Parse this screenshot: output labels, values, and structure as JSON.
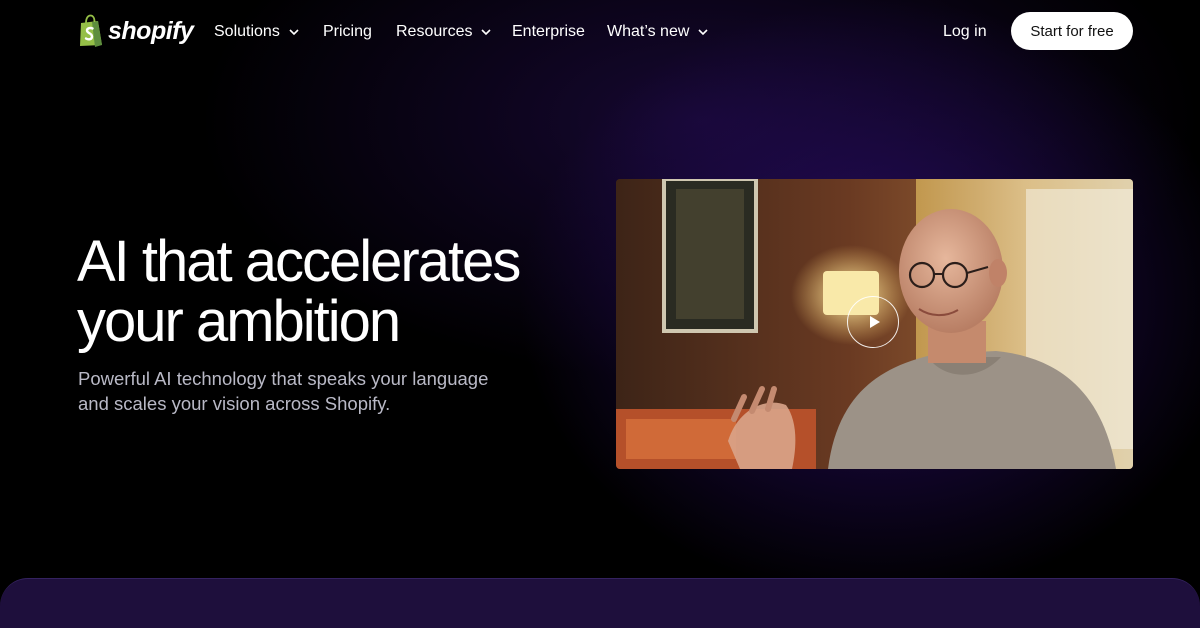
{
  "brand": {
    "name": "shopify",
    "logo_icon": "shopping-bag-icon",
    "logo_color": "#95bf47"
  },
  "nav": {
    "items": [
      {
        "label": "Solutions",
        "has_dropdown": true
      },
      {
        "label": "Pricing",
        "has_dropdown": false
      },
      {
        "label": "Resources",
        "has_dropdown": true
      },
      {
        "label": "Enterprise",
        "has_dropdown": false
      },
      {
        "label": "What’s new",
        "has_dropdown": true
      }
    ],
    "login_label": "Log in",
    "cta_label": "Start for free"
  },
  "hero": {
    "headline": "AI that accelerates your ambition",
    "subline": "Powerful AI technology that speaks your language and scales your vision across Shopify."
  },
  "video": {
    "play_icon": "play-icon"
  },
  "colors": {
    "background": "#000000",
    "glow": "#3e1496",
    "cta_bg": "#ffffff",
    "subtext": "#b9b9c6"
  }
}
